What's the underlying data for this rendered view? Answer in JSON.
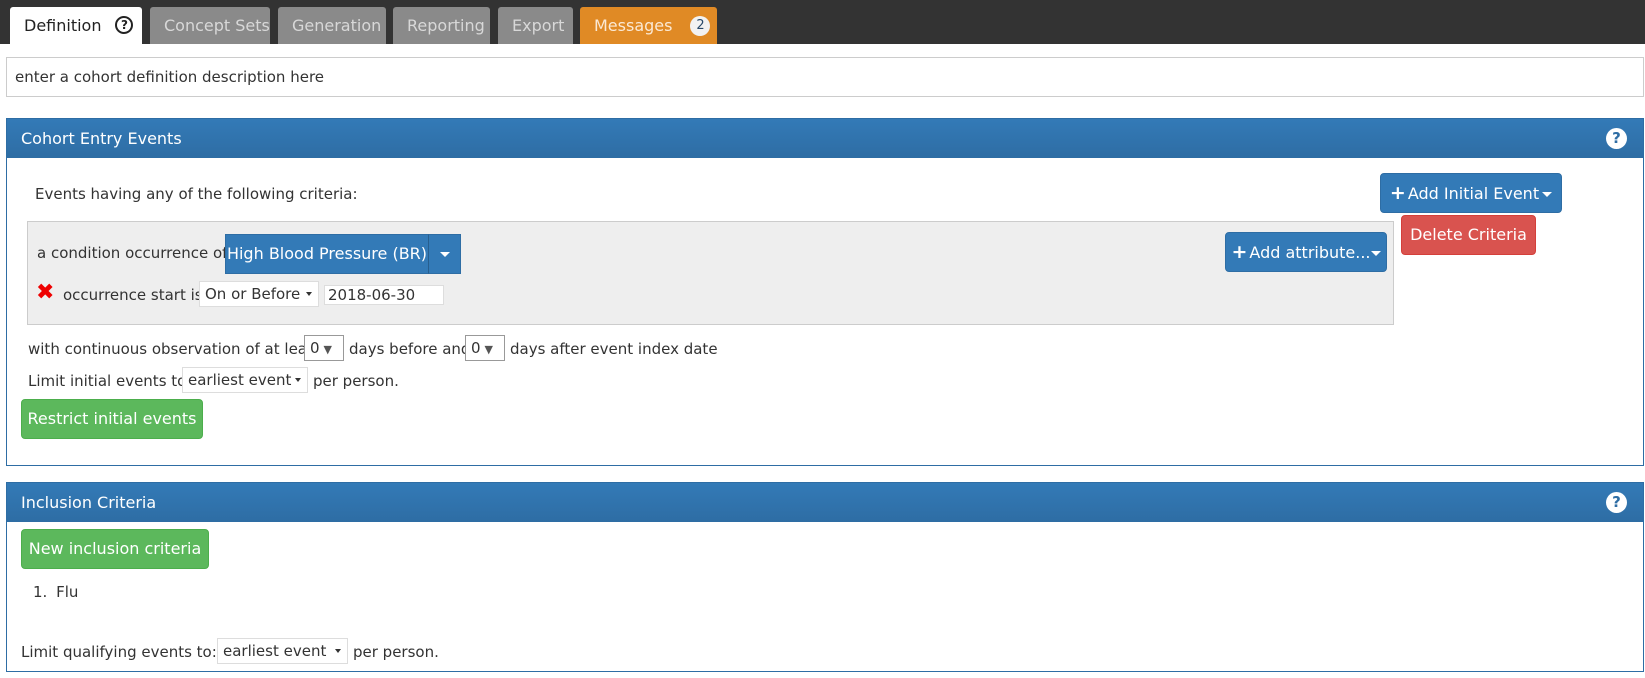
{
  "tabs": [
    {
      "label": "Definition",
      "active": true,
      "has_help": true
    },
    {
      "label": "Concept Sets"
    },
    {
      "label": "Generation"
    },
    {
      "label": "Reporting"
    },
    {
      "label": "Export"
    },
    {
      "label": "Messages",
      "badge": "2"
    }
  ],
  "description": {
    "value": "enter a cohort definition description here"
  },
  "entry_events": {
    "title": "Cohort Entry Events",
    "help_icon": "question-circle-icon",
    "intro": "Events having any of the following criteria:",
    "add_initial_event_label": "Add Initial Event",
    "criteria": {
      "prefix": "a condition occurrence of",
      "concept_set": "High Blood Pressure (BR)",
      "add_attribute_label": "Add attribute...",
      "delete_label": "Delete Criteria",
      "occurrence_start_label": "occurrence start is:",
      "occurrence_start_op": "On or Before",
      "occurrence_start_date": "2018-06-30"
    },
    "observation": {
      "prefix": "with continuous observation of at least",
      "days_before": "0",
      "middle": "days before and",
      "days_after": "0",
      "suffix": "days after event index date"
    },
    "limit": {
      "prefix": "Limit initial events to:",
      "value": "earliest event",
      "suffix": "per person."
    },
    "restrict_label": "Restrict initial events"
  },
  "inclusion": {
    "title": "Inclusion Criteria",
    "new_label": "New inclusion criteria",
    "items": [
      {
        "index": "1.",
        "name": "Flu"
      }
    ],
    "limit": {
      "prefix": "Limit qualifying events to:",
      "value": "earliest event",
      "suffix": "per person."
    }
  },
  "colors": {
    "primary": "#337ab7",
    "success": "#5cb85c",
    "danger": "#d9534f",
    "messages_tab": "#e08a25",
    "topbar": "#333333"
  }
}
